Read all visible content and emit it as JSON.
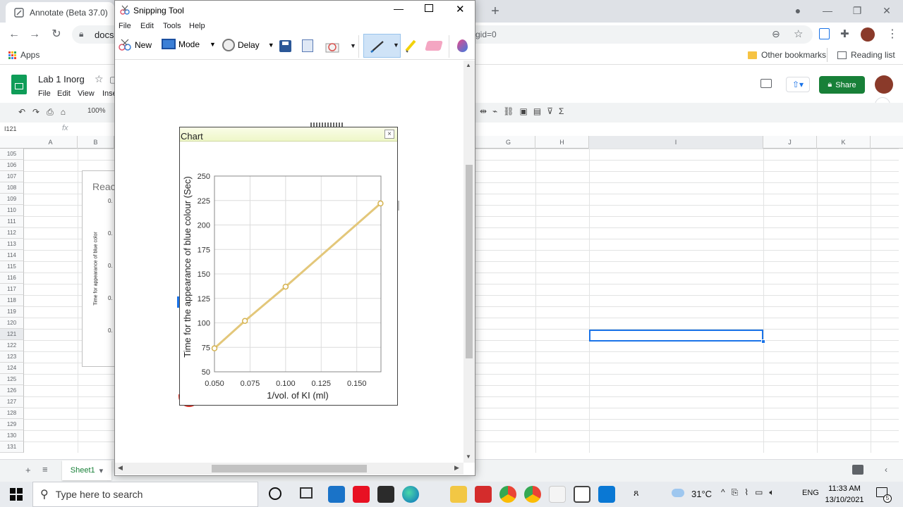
{
  "browser": {
    "tab_title": "Annotate (Beta 37.0)",
    "url_left": "docs.",
    "url_right": "gid=0",
    "bookmarks": {
      "apps": "Apps",
      "other": "Other bookmarks",
      "reading": "Reading list"
    }
  },
  "sheets": {
    "doc_title": "Lab 1 Inorg",
    "menus": [
      "File",
      "Edit",
      "View",
      "Inse"
    ],
    "zoom": "100%",
    "cell_ref": "I121",
    "fx": "fx",
    "share_label": "Share",
    "columns_left": [
      "A",
      "B"
    ],
    "columns_right": [
      "G",
      "H",
      "I",
      "J",
      "K"
    ],
    "rows": [
      "105",
      "106",
      "107",
      "108",
      "109",
      "110",
      "111",
      "112",
      "113",
      "114",
      "115",
      "116",
      "117",
      "118",
      "119",
      "120",
      "121",
      "122",
      "123",
      "124",
      "125",
      "126",
      "127",
      "128",
      "129",
      "130",
      "131"
    ],
    "sheet_tab": "Sheet1",
    "mini_chart": {
      "title_fragment": "Reac",
      "ylabel": "Time for appearance of blue color",
      "ticks": [
        "0.",
        "0.",
        "0.",
        "0.",
        "0."
      ]
    }
  },
  "snipping_tool": {
    "title": "Snipping Tool",
    "menus": [
      "File",
      "Edit",
      "Tools",
      "Help"
    ],
    "toolbar": {
      "new": "New",
      "mode": "Mode",
      "delay": "Delay"
    }
  },
  "chart_window": {
    "title": "Chart",
    "close": "×"
  },
  "chart_data": {
    "type": "line",
    "title": "",
    "xlabel": "1/vol. of KI (ml)",
    "ylabel": "Time for the appearance of blue colour (Sec)",
    "x_ticks": [
      "0.050",
      "0.075",
      "0.100",
      "0.125",
      "0.150"
    ],
    "y_ticks": [
      "50",
      "75",
      "100",
      "125",
      "150",
      "175",
      "200",
      "225",
      "250"
    ],
    "xlim": [
      0.05,
      0.167
    ],
    "ylim": [
      50,
      250
    ],
    "grid": true,
    "series": [
      {
        "color": "#e3c77a",
        "x": [
          0.05,
          0.0714,
          0.1,
          0.1667
        ],
        "y": [
          74,
          102,
          137,
          222
        ]
      }
    ]
  },
  "taskbar": {
    "search_placeholder": "Type here to search",
    "weather": "31°C",
    "lang": "ENG",
    "time": "11:33 AM",
    "date": "13/10/2021",
    "notif_count": "5"
  }
}
